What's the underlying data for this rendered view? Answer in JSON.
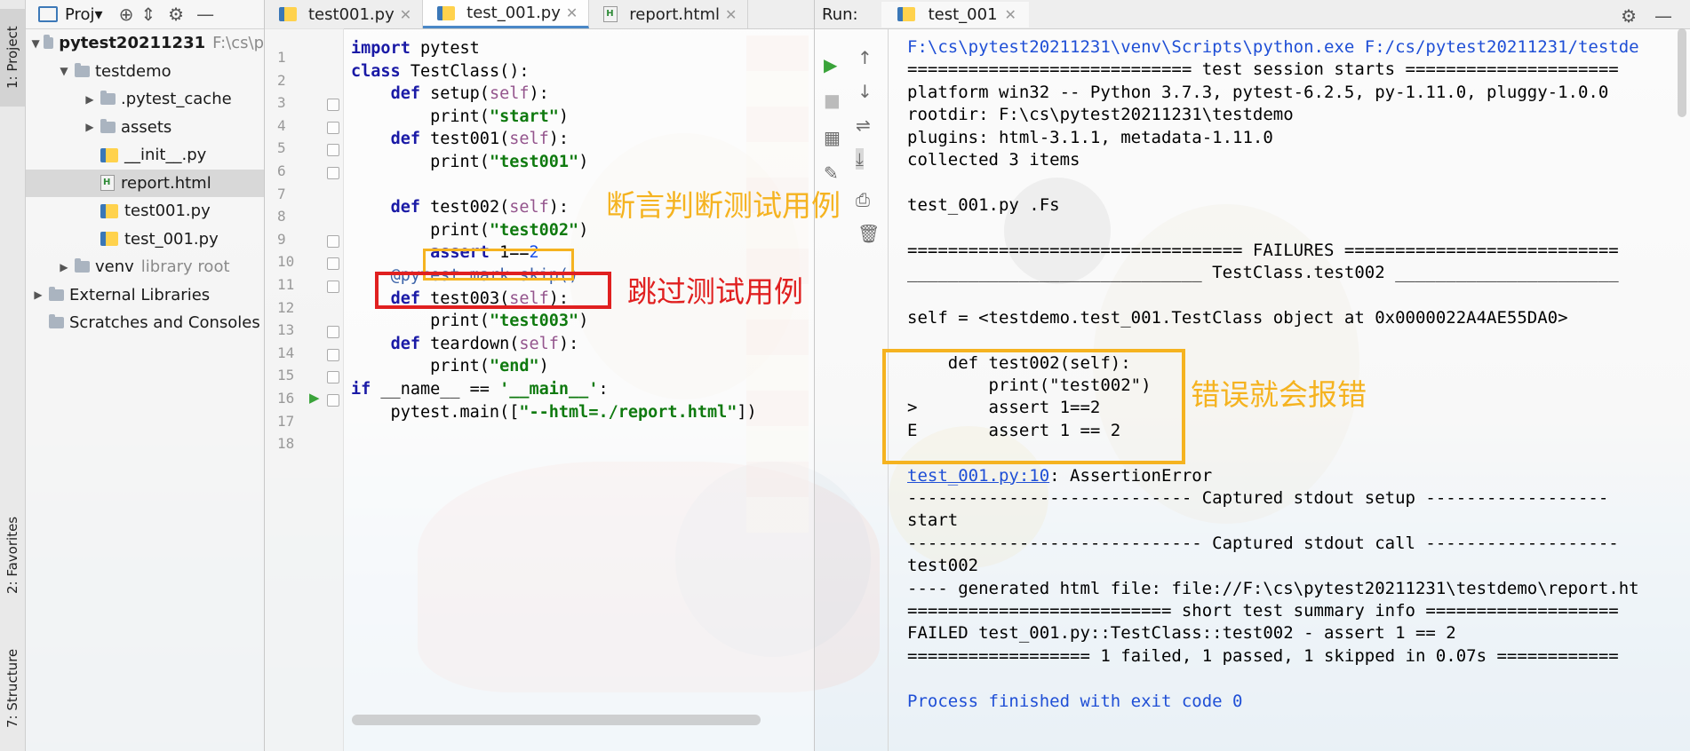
{
  "project": {
    "title": "Proj▾",
    "tree": [
      {
        "label": "pytest20211231",
        "hint": "F:\\cs\\p",
        "level": 0,
        "expanded": true,
        "kind": "folder",
        "bold": true
      },
      {
        "label": "testdemo",
        "level": 1,
        "expanded": true,
        "kind": "folder"
      },
      {
        "label": ".pytest_cache",
        "level": 2,
        "expanded": false,
        "kind": "folder"
      },
      {
        "label": "assets",
        "level": 2,
        "expanded": false,
        "kind": "folder"
      },
      {
        "label": "__init__.py",
        "level": 2,
        "kind": "py"
      },
      {
        "label": "report.html",
        "level": 2,
        "kind": "html",
        "selected": true
      },
      {
        "label": "test001.py",
        "level": 2,
        "kind": "py"
      },
      {
        "label": "test_001.py",
        "level": 2,
        "kind": "py"
      },
      {
        "label": "venv",
        "hint": "library root",
        "level": 1,
        "expanded": false,
        "kind": "folder"
      },
      {
        "label": "External Libraries",
        "level": 0,
        "expanded": false,
        "kind": "lib"
      },
      {
        "label": "Scratches and Consoles",
        "level": 0,
        "kind": "scratch"
      }
    ]
  },
  "side_tabs": {
    "project": "1: Project",
    "favorites": "2: Favorites",
    "structure": "7: Structure"
  },
  "editor": {
    "tabs": [
      {
        "label": "test001.py",
        "active": false
      },
      {
        "label": "test_001.py",
        "active": true
      },
      {
        "label": "report.html",
        "active": false
      }
    ],
    "lines": [
      "1",
      "2",
      "3",
      "4",
      "5",
      "6",
      "7",
      "8",
      "9",
      "10",
      "11",
      "12",
      "13",
      "14",
      "15",
      "16",
      "17",
      "18"
    ]
  },
  "run": {
    "label": "Run:",
    "tab": "test_001",
    "output": [
      "F:\\cs\\pytest20211231\\venv\\Scripts\\python.exe F:/cs/pytest20211231/testde",
      "============================ test session starts =====================",
      "platform win32 -- Python 3.7.3, pytest-6.2.5, py-1.11.0, pluggy-1.0.0",
      "rootdir: F:\\cs\\pytest20211231\\testdemo",
      "plugins: html-3.1.1, metadata-1.11.0",
      "collected 3 items",
      "",
      "test_001.py .Fs",
      "",
      "================================= FAILURES ===========================",
      "_____________________________ TestClass.test002 ______________________",
      "",
      "self = <testdemo.test_001.TestClass object at 0x0000022A4AE55DA0>",
      "",
      "    def test002(self):",
      "        print(\"test002\")",
      ">       assert 1==2",
      "E       assert 1 == 2",
      "",
      "",
      "---------------------------- Captured stdout setup ------------------",
      "start",
      "----------------------------- Captured stdout call -------------------",
      "test002",
      "---- generated html file: file://F:\\cs\\pytest20211231\\testdemo\\report.ht",
      "========================== short test summary info ===================",
      "FAILED test_001.py::TestClass::test002 - assert 1 == 2",
      "================== 1 failed, 1 passed, 1 skipped in 0.07s ============",
      "",
      "Process finished with exit code 0"
    ],
    "error_link": "test_001.py:10",
    "error_rest": ": AssertionError"
  },
  "annotations": {
    "assert_note": "断言判断测试用例",
    "skip_note": "跳过测试用例",
    "error_note": "错误就会报错"
  },
  "colors": {
    "orange": "#f5b320",
    "red": "#e02020",
    "keyword": "#1a1aa6",
    "string": "#0f7a0f"
  }
}
